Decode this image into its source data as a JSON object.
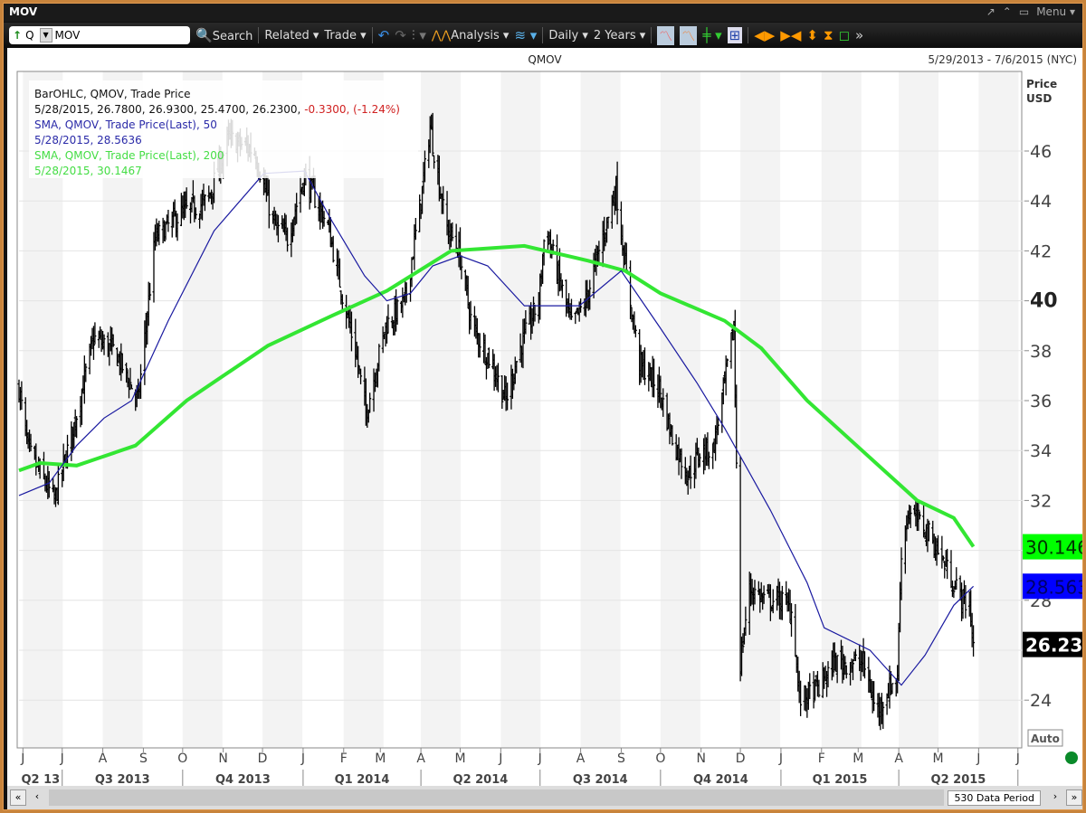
{
  "window": {
    "title": "MOV",
    "menu_label": "Menu"
  },
  "toolbar": {
    "symbol_prefix": "Q",
    "symbol": "MOV",
    "search": "Search",
    "related": "Related",
    "trade": "Trade",
    "analysis": "Analysis",
    "interval": "Daily",
    "span": "2 Years"
  },
  "header": {
    "symbol": "QMOV",
    "date_range": "5/29/2013 - 7/6/2015 (NYC)"
  },
  "legend": {
    "line1": "BarOHLC, QMOV, Trade Price",
    "line2": "5/28/2015, 26.7800, 26.9300, 25.4700, 26.2300,",
    "line2_change": "-0.3300, (-1.24%)",
    "line3": "SMA, QMOV, Trade Price(Last),  50",
    "line4": "5/28/2015, 28.5636",
    "line5": "SMA, QMOV, Trade Price(Last),  200",
    "line6": "5/28/2015, 30.1467"
  },
  "axis": {
    "title1": "Price",
    "title2": "USD",
    "auto": "Auto"
  },
  "tags": {
    "sma200": "30.146",
    "sma50": "28.563",
    "last": "26.23"
  },
  "bottom": {
    "period": "530 Data Period"
  },
  "colors": {
    "sma50": "#1a1aa0",
    "sma200": "#33e633",
    "bar": "#000000",
    "tag200": "#00ff00",
    "tag50": "#0000ff",
    "taglast": "#000000"
  },
  "chart_data": {
    "type": "line",
    "title": "QMOV",
    "ylabel": "Price USD",
    "ylim": [
      23,
      48
    ],
    "yticks": [
      24,
      26,
      28,
      30,
      32,
      34,
      36,
      38,
      40,
      42,
      44,
      46
    ],
    "xrange": [
      "2013-05-29",
      "2015-07-06"
    ],
    "months": [
      "J",
      "J",
      "A",
      "S",
      "O",
      "N",
      "D",
      "J",
      "F",
      "M",
      "A",
      "M",
      "J",
      "J",
      "A",
      "S",
      "O",
      "N",
      "D",
      "J",
      "F",
      "M",
      "A",
      "M",
      "J",
      "J"
    ],
    "quarters": [
      "Q2 13",
      "Q3 2013",
      "Q4 2013",
      "Q1 2014",
      "Q2 2014",
      "Q3 2014",
      "Q4 2014",
      "Q1 2015",
      "Q2 2015"
    ],
    "series": [
      {
        "name": "BarOHLC QMOV (approx. closes)",
        "points": [
          [
            "2013-05-29",
            36.5
          ],
          [
            "2013-06-05",
            34
          ],
          [
            "2013-06-25",
            32
          ],
          [
            "2013-07-10",
            35
          ],
          [
            "2013-07-25",
            38.5
          ],
          [
            "2013-08-10",
            38
          ],
          [
            "2013-08-28",
            36
          ],
          [
            "2013-09-10",
            42.5
          ],
          [
            "2013-09-30",
            43.5
          ],
          [
            "2013-10-20",
            44
          ],
          [
            "2013-11-05",
            46.5
          ],
          [
            "2013-11-25",
            46
          ],
          [
            "2013-12-10",
            43
          ],
          [
            "2013-12-20",
            42.5
          ],
          [
            "2014-01-02",
            45
          ],
          [
            "2014-01-20",
            43
          ],
          [
            "2014-02-01",
            40
          ],
          [
            "2014-02-10",
            38
          ],
          [
            "2014-02-18",
            35.5
          ],
          [
            "2014-03-05",
            39
          ],
          [
            "2014-03-20",
            40
          ],
          [
            "2014-04-01",
            44
          ],
          [
            "2014-04-08",
            47
          ],
          [
            "2014-04-20",
            43
          ],
          [
            "2014-04-30",
            42
          ],
          [
            "2014-05-10",
            39
          ],
          [
            "2014-05-25",
            37.5
          ],
          [
            "2014-06-05",
            36
          ],
          [
            "2014-06-15",
            38
          ],
          [
            "2014-06-30",
            40
          ],
          [
            "2014-07-05",
            43
          ],
          [
            "2014-07-15",
            41
          ],
          [
            "2014-07-25",
            39
          ],
          [
            "2014-08-05",
            40
          ],
          [
            "2014-08-15",
            42
          ],
          [
            "2014-08-28",
            44.5
          ],
          [
            "2014-09-05",
            41
          ],
          [
            "2014-09-15",
            37.5
          ],
          [
            "2014-09-30",
            36.5
          ],
          [
            "2014-10-10",
            34.5
          ],
          [
            "2014-10-22",
            33
          ],
          [
            "2014-11-01",
            34
          ],
          [
            "2014-11-10",
            34
          ],
          [
            "2014-11-20",
            37
          ],
          [
            "2014-11-26",
            39
          ],
          [
            "2014-12-01",
            25.5
          ],
          [
            "2014-12-08",
            28.5
          ],
          [
            "2014-12-20",
            28
          ],
          [
            "2015-01-02",
            28
          ],
          [
            "2015-01-10",
            27.5
          ],
          [
            "2015-01-15",
            24
          ],
          [
            "2015-01-30",
            24.5
          ],
          [
            "2015-02-10",
            25.5
          ],
          [
            "2015-02-25",
            25.5
          ],
          [
            "2015-03-05",
            25.5
          ],
          [
            "2015-03-15",
            23.5
          ],
          [
            "2015-03-25",
            24.5
          ],
          [
            "2015-03-31",
            25
          ],
          [
            "2015-04-03",
            30
          ],
          [
            "2015-04-08",
            31.5
          ],
          [
            "2015-04-20",
            31
          ],
          [
            "2015-05-01",
            30
          ],
          [
            "2015-05-10",
            29
          ],
          [
            "2015-05-20",
            28
          ],
          [
            "2015-05-25",
            27.8
          ],
          [
            "2015-05-28",
            26.23
          ]
        ]
      },
      {
        "name": "SMA 50",
        "points": [
          [
            "2013-05-29",
            32.2
          ],
          [
            "2013-06-21",
            32.7
          ],
          [
            "2013-07-12",
            34.2
          ],
          [
            "2013-08-02",
            35.3
          ],
          [
            "2013-08-23",
            36
          ],
          [
            "2013-09-20",
            39.2
          ],
          [
            "2013-10-25",
            42.8
          ],
          [
            "2013-12-02",
            45.1
          ],
          [
            "2014-01-02",
            45.2
          ],
          [
            "2014-01-23",
            43.2
          ],
          [
            "2014-02-17",
            41
          ],
          [
            "2014-03-06",
            40
          ],
          [
            "2014-03-24",
            40.3
          ],
          [
            "2014-04-10",
            41.4
          ],
          [
            "2014-05-01",
            41.8
          ],
          [
            "2014-05-22",
            41.4
          ],
          [
            "2014-06-19",
            39.8
          ],
          [
            "2014-07-31",
            39.8
          ],
          [
            "2014-09-01",
            41.2
          ],
          [
            "2014-10-01",
            38.9
          ],
          [
            "2014-10-29",
            36.7
          ],
          [
            "2014-11-19",
            34.9
          ],
          [
            "2014-12-24",
            31.6
          ],
          [
            "2015-01-21",
            28.7
          ],
          [
            "2015-02-03",
            26.9
          ],
          [
            "2015-03-10",
            26
          ],
          [
            "2015-04-03",
            24.6
          ],
          [
            "2015-04-21",
            25.8
          ],
          [
            "2015-05-13",
            27.8
          ],
          [
            "2015-05-28",
            28.56
          ]
        ]
      },
      {
        "name": "SMA 200",
        "points": [
          [
            "2013-05-29",
            33.2
          ],
          [
            "2013-06-14",
            33.5
          ],
          [
            "2013-07-12",
            33.4
          ],
          [
            "2013-08-26",
            34.2
          ],
          [
            "2013-10-04",
            36
          ],
          [
            "2013-12-05",
            38.2
          ],
          [
            "2014-01-23",
            39.4
          ],
          [
            "2014-03-06",
            40.4
          ],
          [
            "2014-04-24",
            42
          ],
          [
            "2014-06-19",
            42.2
          ],
          [
            "2014-08-07",
            41.6
          ],
          [
            "2014-09-04",
            41.2
          ],
          [
            "2014-10-01",
            40.3
          ],
          [
            "2014-11-19",
            39.2
          ],
          [
            "2014-12-17",
            38.1
          ],
          [
            "2015-01-21",
            36
          ],
          [
            "2015-03-04",
            34
          ],
          [
            "2015-04-15",
            32
          ],
          [
            "2015-05-13",
            31.3
          ],
          [
            "2015-05-28",
            30.15
          ]
        ]
      }
    ]
  }
}
